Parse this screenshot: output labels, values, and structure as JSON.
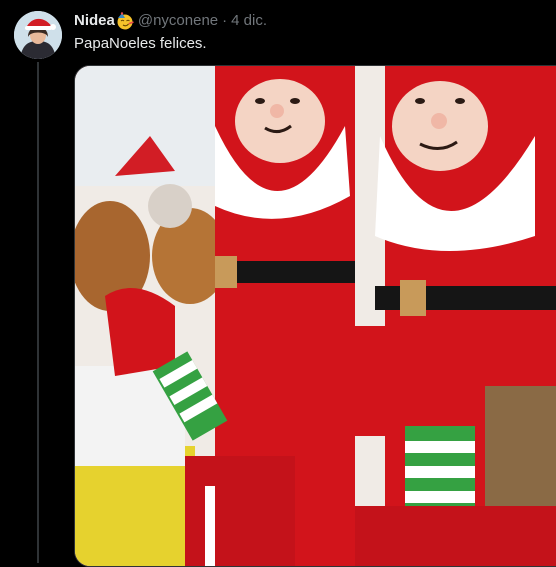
{
  "tweet": {
    "author": {
      "display_name": "Nidea",
      "name_emoji": "partying-face-emoji",
      "handle": "@nyconene"
    },
    "separator": "·",
    "date": "4 dic.",
    "text": "PapaNoeles felices."
  },
  "colors": {
    "background": "#000000",
    "text_primary": "#e7e9ea",
    "text_secondary": "#71767b",
    "border": "#2f3336"
  },
  "icons": {
    "avatar": "user-avatar-with-santa-hat",
    "media": "photo-of-santa-claus-plush-toys"
  }
}
